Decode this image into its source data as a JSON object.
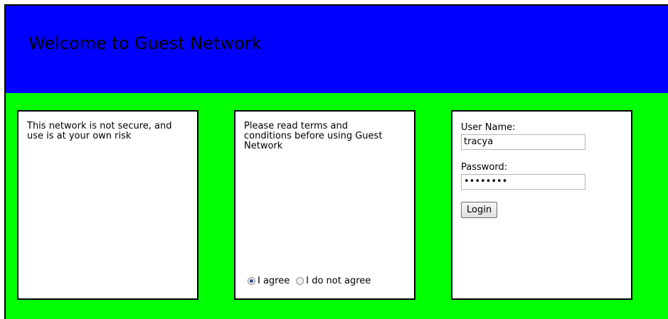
{
  "header": {
    "title": "Welcome to Guest Network"
  },
  "left_panel": {
    "text": "This network is not secure, and use is at your own risk"
  },
  "middle_panel": {
    "text": "Please read terms and conditions before using Guest Network",
    "agree_label": "I agree",
    "disagree_label": "I do not agree",
    "selected": "I agree"
  },
  "login_panel": {
    "username_label": "User Name:",
    "username_value": "tracya",
    "password_label": "Password:",
    "password_mask": "••••••••",
    "login_button": "Login"
  },
  "colors": {
    "header": "#0000ff",
    "body": "#00ff00",
    "panel": "#ffffff"
  }
}
